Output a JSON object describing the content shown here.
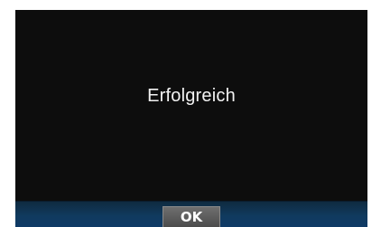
{
  "dialog": {
    "message": "Erfolgreich",
    "ok_label": "OK"
  },
  "colors": {
    "background": "#0d0d0d",
    "footer": "#103a5e",
    "button": "#5c5c5c",
    "text": "#f2f2f2"
  }
}
